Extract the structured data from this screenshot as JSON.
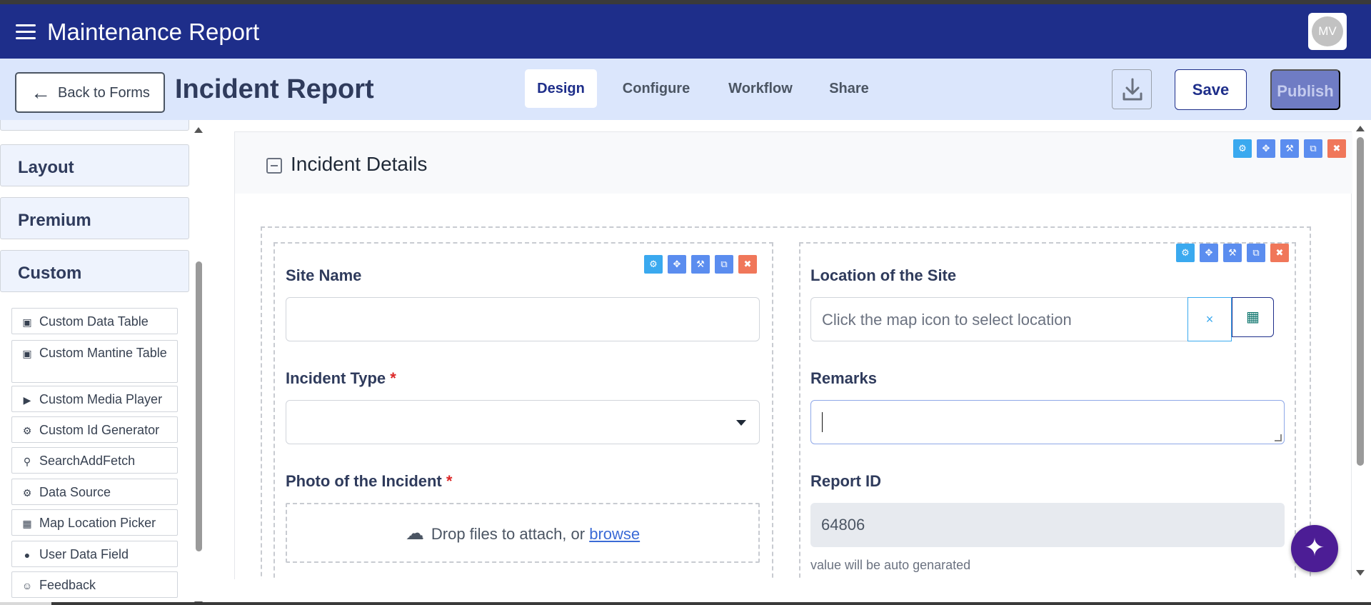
{
  "header": {
    "app_title": "Maintenance Report",
    "avatar_initials": "MV"
  },
  "toolbar": {
    "back_label": "Back to Forms",
    "form_title": "Incident Report",
    "tabs": [
      {
        "label": "Design",
        "active": true
      },
      {
        "label": "Configure",
        "active": false
      },
      {
        "label": "Workflow",
        "active": false
      },
      {
        "label": "Share",
        "active": false
      }
    ],
    "download_icon": "download-icon",
    "save_label": "Save",
    "publish_label": "Publish"
  },
  "sidebar": {
    "groups": [
      "Layout",
      "Premium",
      "Custom"
    ],
    "components": [
      {
        "label": "Custom Data Table",
        "icon": "html5-icon"
      },
      {
        "label": "Custom Mantine Table",
        "icon": "html5-icon"
      },
      {
        "label": "Custom Media Player",
        "icon": "play-circle-icon"
      },
      {
        "label": "Custom Id Generator",
        "icon": "cogs-icon"
      },
      {
        "label": "SearchAddFetch",
        "icon": "search-icon"
      },
      {
        "label": "Data Source",
        "icon": "cogs-icon"
      },
      {
        "label": "Map Location Picker",
        "icon": "map-icon"
      },
      {
        "label": "User Data Field",
        "icon": "user-icon"
      },
      {
        "label": "Feedback",
        "icon": "smile-icon"
      }
    ]
  },
  "panel": {
    "title": "Incident Details"
  },
  "fields": {
    "site_name": {
      "label": "Site Name",
      "value": ""
    },
    "incident_type": {
      "label": "Incident Type",
      "required_mark": "*",
      "value": ""
    },
    "photo": {
      "label": "Photo of the Incident",
      "required_mark": "*",
      "drop_text": "Drop files to attach, or ",
      "browse_text": "browse"
    },
    "location": {
      "label": "Location of the Site",
      "placeholder": "Click the map icon to select location",
      "clear_symbol": "×"
    },
    "remarks": {
      "label": "Remarks",
      "value": ""
    },
    "report_id": {
      "label": "Report ID",
      "value": "64806",
      "hint": "value will be auto genarated"
    }
  },
  "colors": {
    "appbar": "#1e2e8a",
    "subbar": "#dbe6fc",
    "publish": "#6f7cc4",
    "tool_blue": "#5b8def",
    "tool_delete": "#f0775a"
  }
}
